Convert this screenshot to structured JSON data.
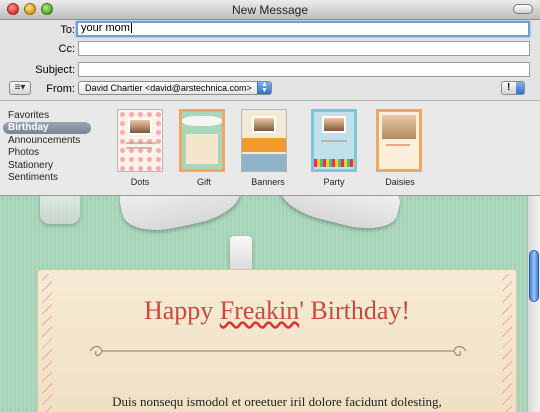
{
  "window": {
    "title": "New Message"
  },
  "header": {
    "to_label": "To:",
    "to_value": "your mom",
    "cc_label": "Cc:",
    "cc_value": "",
    "subject_label": "Subject:",
    "subject_value": "",
    "from_label": "From:",
    "from_value": "David Chartier <david@arstechnica.com>",
    "priority_label": "!"
  },
  "stationery": {
    "categories": [
      "Favorites",
      "Birthday",
      "Announcements",
      "Photos",
      "Stationery",
      "Sentiments"
    ],
    "selected_category": "Birthday",
    "templates": [
      "Dots",
      "Gift",
      "Banners",
      "Party",
      "Daisies"
    ]
  },
  "message": {
    "title_part1": "Happy ",
    "title_misspelled": "Freakin",
    "title_part2": "' Birthday!",
    "body_text": "Duis nonsequ ismodol et oreetuer iril dolore facidunt dolesting,"
  },
  "colors": {
    "accent_blue": "#3e7fd6",
    "card_title": "#c84a3c",
    "compose_background": "#a9d7bc"
  }
}
